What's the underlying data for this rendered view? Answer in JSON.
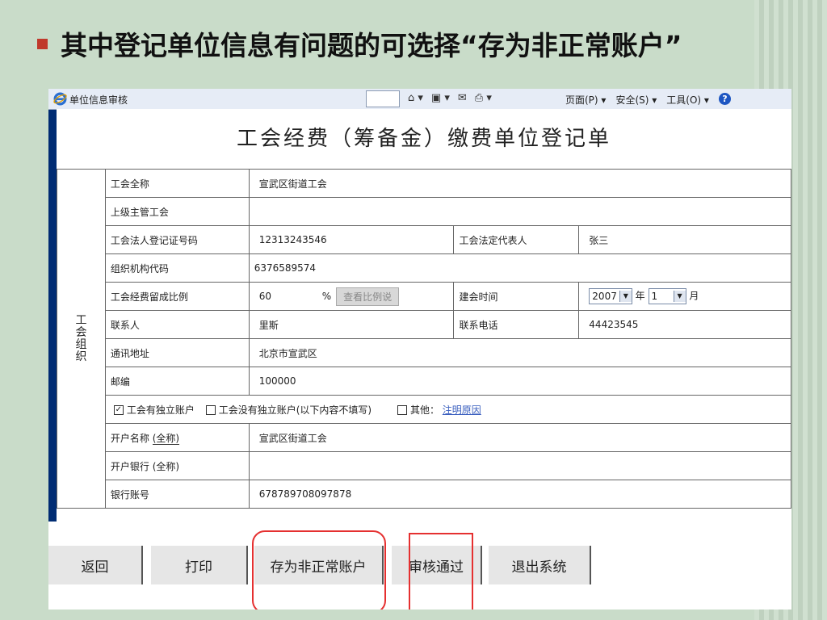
{
  "slide": {
    "title": "其中登记单位信息有问题的可选择“存为非正常账户”"
  },
  "browser": {
    "window_title": "单位信息审核",
    "menus": [
      "页面(P)",
      "安全(S)",
      "工具(O)"
    ],
    "icons": [
      "home-icon",
      "feeds-icon",
      "mail-icon",
      "print-icon",
      "help-icon"
    ]
  },
  "form": {
    "title": "工会经费（筹备金）缴费单位登记单",
    "side_label": "工会组织",
    "rows": {
      "union_name_label": "工会全称",
      "union_name": "宣武区街道工会",
      "parent_union_label": "上级主管工会",
      "parent_union": "",
      "reg_no_label": "工会法人登记证号码",
      "reg_no": "12313243546",
      "legal_rep_label": "工会法定代表人",
      "legal_rep": "张三",
      "org_code_label": "组织机构代码",
      "org_code": "6376589574",
      "ratio_label": "工会经费留成比例",
      "ratio": "60",
      "ratio_unit": "%",
      "ratio_button": "查看比例说",
      "founded_label": "建会时间",
      "founded_year": "2007",
      "year_unit": "年",
      "founded_month": "1",
      "month_unit": "月",
      "contact_label": "联系人",
      "contact": "里斯",
      "phone_label": "联系电话",
      "phone": "44423545",
      "address_label": "通讯地址",
      "address": "北京市宣武区",
      "zip_label": "邮编",
      "zip": "100000",
      "has_account_label": "工会有独立账户",
      "has_account_checked": true,
      "no_account_label": "工会没有独立账户",
      "no_account_note": "(以下内容不填写)",
      "other_label": "其他：",
      "other_link": "注明原因",
      "account_name_label": "开户名称",
      "full_name_note": "(全称)",
      "account_name": "宣武区街道工会",
      "bank_label": "开户银行",
      "bank_note": "(全称)",
      "bank": "",
      "account_no_label": "银行账号",
      "account_no": "678789708097878"
    }
  },
  "buttons": {
    "back": "返回",
    "print": "打印",
    "save_abnormal": "存为非正常账户",
    "approve": "审核通过",
    "exit": "退出系统"
  },
  "colors": {
    "window_border": "#002c73",
    "highlight": "#e53030",
    "bullet": "#c0392b",
    "slide_bg": "#c9dcc9"
  }
}
